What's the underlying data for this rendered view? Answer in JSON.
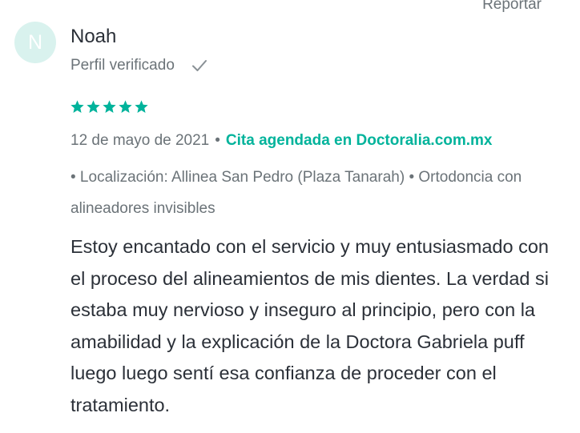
{
  "review": {
    "report_label": "Reportar",
    "avatar_initial": "N",
    "author_name": "Noah",
    "verified_label": "Perfil verificado",
    "rating": 5,
    "rating_max": 5,
    "date": "12 de mayo de 2021",
    "booking_label": "Cita agendada en Doctoralia.com.mx",
    "location_line": "• Localización: Allinea San Pedro (Plaza Tanarah) • Ortodoncia con alineadores invisibles",
    "body": "Estoy encantado con el servicio y muy entusiasmado con el proceso del alineamientos de mis dientes. La verdad si estaba muy nervioso y inseguro al principio, pero con la amabilidad y la explicación de la Doctora Gabriela puff luego luego sentí esa confianza de proceder con el tratamiento."
  },
  "colors": {
    "accent": "#00b39b",
    "avatar_bg": "#d9f2ee",
    "muted_text": "#6b7378",
    "body_text": "#2b3038"
  },
  "icons": {
    "check": "check-icon",
    "star": "star-icon"
  }
}
